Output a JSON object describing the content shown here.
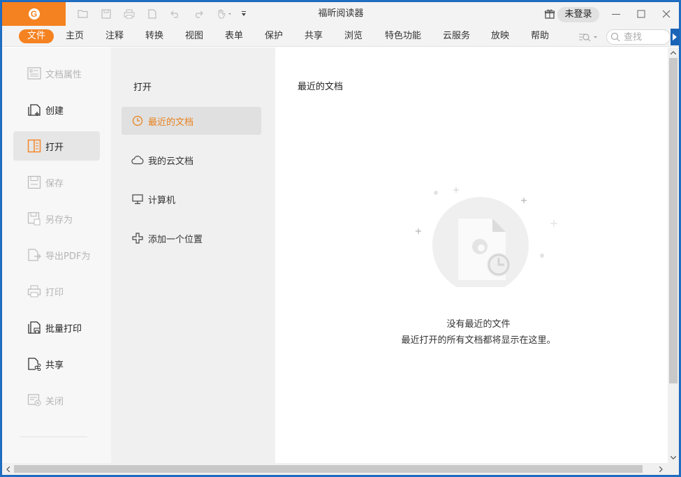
{
  "app": {
    "title": "福昕阅读器",
    "login_label": "未登录",
    "accent_color": "#f58220",
    "logo_letter": "G"
  },
  "quick_access": [
    {
      "name": "open-icon"
    },
    {
      "name": "save-icon"
    },
    {
      "name": "print-icon"
    },
    {
      "name": "new-doc-icon"
    },
    {
      "name": "undo-icon"
    },
    {
      "name": "redo-icon"
    },
    {
      "name": "hand-tool-icon"
    },
    {
      "name": "customize-qa-icon"
    }
  ],
  "tabs": [
    {
      "label": "文件",
      "active": true
    },
    {
      "label": "主页"
    },
    {
      "label": "注释"
    },
    {
      "label": "转换"
    },
    {
      "label": "视图"
    },
    {
      "label": "表单"
    },
    {
      "label": "保护"
    },
    {
      "label": "共享"
    },
    {
      "label": "浏览"
    },
    {
      "label": "特色功能"
    },
    {
      "label": "云服务"
    },
    {
      "label": "放映"
    },
    {
      "label": "帮助"
    }
  ],
  "search": {
    "placeholder": "查找"
  },
  "left_nav": [
    {
      "label": "文档属性",
      "enabled": false,
      "icon": "document-properties-icon"
    },
    {
      "label": "创建",
      "enabled": true,
      "icon": "create-icon"
    },
    {
      "label": "打开",
      "enabled": true,
      "active": true,
      "icon": "open-book-icon"
    },
    {
      "label": "保存",
      "enabled": false,
      "icon": "save-icon"
    },
    {
      "label": "另存为",
      "enabled": false,
      "icon": "save-as-icon"
    },
    {
      "label": "导出PDF为",
      "enabled": false,
      "icon": "export-pdf-icon"
    },
    {
      "label": "打印",
      "enabled": false,
      "icon": "print-icon"
    },
    {
      "label": "批量打印",
      "enabled": true,
      "icon": "batch-print-icon"
    },
    {
      "label": "共享",
      "enabled": true,
      "icon": "share-icon"
    },
    {
      "label": "关闭",
      "enabled": false,
      "icon": "close-doc-icon"
    }
  ],
  "open_panel": {
    "title": "打开",
    "locations": [
      {
        "label": "最近的文档",
        "active": true,
        "icon": "clock-icon"
      },
      {
        "label": "我的云文档",
        "icon": "cloud-icon"
      },
      {
        "label": "计算机",
        "icon": "computer-icon"
      },
      {
        "label": "添加一个位置",
        "icon": "add-location-icon"
      }
    ]
  },
  "content": {
    "title": "最近的文档",
    "empty_line1": "没有最近的文件",
    "empty_line2": "最近打开的所有文档都将显示在这里。"
  }
}
